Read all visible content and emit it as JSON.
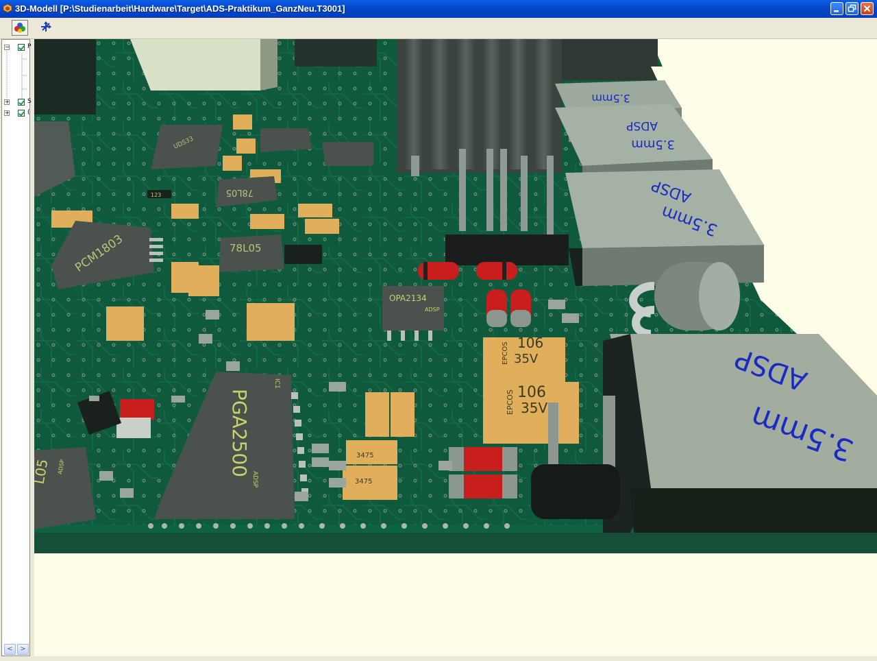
{
  "window": {
    "title": "3D-Modell  [P:\\Studienarbeit\\Hardware\\Target\\ADS-Praktikum_GanzNeu.T3001]",
    "buttons": [
      "minimize",
      "maximize",
      "close"
    ]
  },
  "toolbar": {
    "buttons": [
      {
        "icon": "color-layers-icon",
        "pressed": true
      },
      {
        "icon": "axis-view-icon",
        "pressed": false
      }
    ]
  },
  "tree": {
    "items": [
      {
        "expander": "−",
        "checked": true,
        "label": "P"
      },
      {
        "expander": "+",
        "checked": true,
        "label": "S"
      },
      {
        "expander": "+",
        "checked": true,
        "label": "("
      }
    ]
  },
  "scrollbar": {
    "left": "<",
    "right": ">"
  },
  "board": {
    "colors": {
      "pcb": "#0f5a3c",
      "background": "#fefde8",
      "component_grey": "#4b514c",
      "tantalum": "#e1ae5b",
      "diode_red": "#c91e1e",
      "heatsink": "#4e5650"
    },
    "component_labels": {
      "pcm": "PCM1803",
      "reg1": "78L05",
      "reg2": "78L05",
      "opa": "OPA2134",
      "opa_sub": "ADSP",
      "pga": "PGA2500",
      "pga_sub": "ADSP",
      "pga_id": "IC1",
      "l05": "L05",
      "l05_sub": "ADSP",
      "cap1_brand": "EPCOS",
      "cap1_val": "106",
      "cap1_v": "35V",
      "cap2_brand": "EPCOS",
      "cap2_val": "106",
      "cap2_v": "35V",
      "tant_475a": "3475",
      "tant_475b": "3475",
      "jack1_a": "ADSP",
      "jack1_b": "3.5mm",
      "jack2_a": "ADSP",
      "jack2_b": "3.5mm",
      "jack3_a": "ADSP",
      "jack3_b": "3.5mm",
      "jack4_b": "3.5mm",
      "chip_t": "UDS33",
      "res_123": "123"
    }
  }
}
